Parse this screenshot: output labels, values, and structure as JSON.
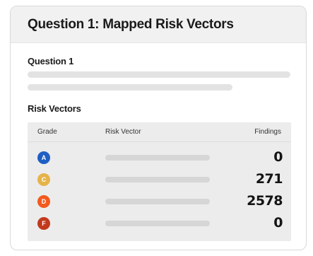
{
  "card": {
    "title": "Question 1: Mapped Risk Vectors"
  },
  "question": {
    "label": "Question 1"
  },
  "risk_vectors": {
    "heading": "Risk Vectors",
    "columns": {
      "grade": "Grade",
      "vector": "Risk Vector",
      "findings": "Findings"
    },
    "rows": [
      {
        "grade": "A",
        "color": "#1f5fc4",
        "findings": "0"
      },
      {
        "grade": "C",
        "color": "#e6b34a",
        "findings": "271"
      },
      {
        "grade": "D",
        "color": "#f25a1e",
        "findings": "2578"
      },
      {
        "grade": "F",
        "color": "#c2391c",
        "findings": "0"
      }
    ]
  }
}
